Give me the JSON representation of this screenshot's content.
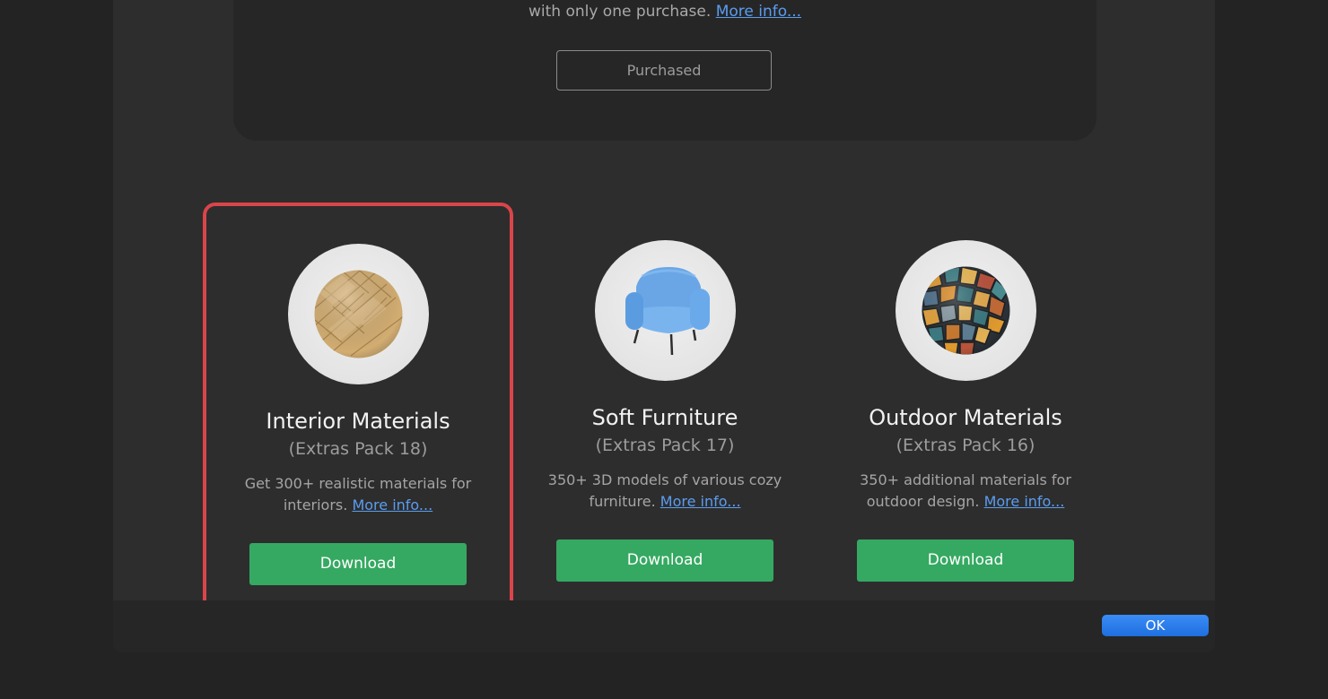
{
  "top_card": {
    "text": "with only one purchase.",
    "link": "More info...",
    "button_label": "Purchased"
  },
  "packs": [
    {
      "title": "Interior Materials",
      "subtitle": "(Extras Pack 18)",
      "desc_line1": "Get 300+ realistic materials for",
      "desc_line2": "interiors.",
      "link": "More info...",
      "button_label": "Download",
      "icon": "wood-herringbone-sphere-icon",
      "highlighted": true
    },
    {
      "title": "Soft Furniture",
      "subtitle": "(Extras Pack 17)",
      "desc_line1": "350+ 3D models of various cozy",
      "desc_line2": "furniture.",
      "link": "More info...",
      "button_label": "Download",
      "icon": "armchair-icon",
      "highlighted": false
    },
    {
      "title": "Outdoor Materials",
      "subtitle": "(Extras Pack 16)",
      "desc_line1": "350+ additional materials for",
      "desc_line2": "outdoor design.",
      "link": "More info...",
      "button_label": "Download",
      "icon": "mosaic-tile-sphere-icon",
      "highlighted": false
    }
  ],
  "footer": {
    "ok_label": "OK"
  },
  "colors": {
    "download_green": "#35a961",
    "link_blue": "#5b9cf0",
    "highlight_red": "#d9454a",
    "ok_blue": "#1f6fe0"
  }
}
